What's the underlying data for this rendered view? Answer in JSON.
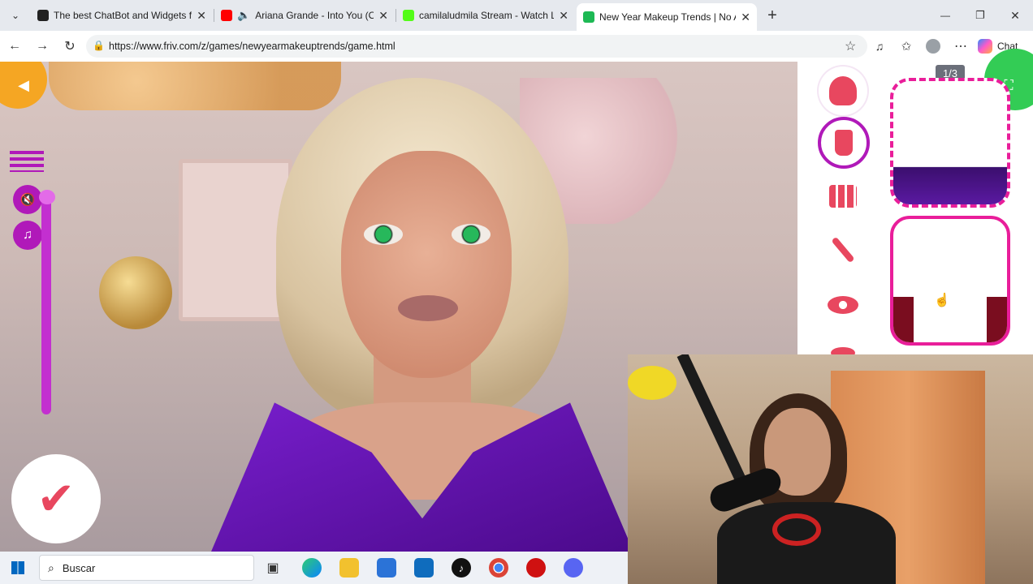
{
  "tabs": [
    {
      "title": "The best ChatBot and Widgets for",
      "favicon_color": "#222222"
    },
    {
      "title": "Ariana Grande - Into You (Offi",
      "favicon_color": "#ff0000"
    },
    {
      "title": "camilaludmila Stream - Watch Live",
      "favicon_color": "#53fc18"
    },
    {
      "title": "New Year Makeup Trends | No Ads",
      "favicon_color": "#1db954"
    }
  ],
  "close_glyph": "✕",
  "new_tab_glyph": "+",
  "window_controls": {
    "minimize": "—",
    "restore": "❐",
    "close": "✕"
  },
  "url": "https://www.friv.com/z/games/newyearmakeuptrends/game.html",
  "chat_label": "Chat",
  "game": {
    "page_indicator": "1/3",
    "categories": [
      "hair-icon",
      "top-icon",
      "palette-icon",
      "brush-icon",
      "eye-icon",
      "lips-icon"
    ],
    "selected_category": "top-icon",
    "confirm_glyph": "✔",
    "back_glyph": "◀"
  },
  "taskbar": {
    "search_placeholder": "Buscar",
    "apps": [
      "task-view",
      "edge",
      "file-explorer",
      "store",
      "outlook",
      "tiktok",
      "chrome",
      "red-app",
      "discord"
    ]
  },
  "colors": {
    "accent_pink": "#e91e9a",
    "selected_purple": "#b019b9",
    "dress_purple": "#5a0f9c",
    "confirm_red": "#e8475f"
  }
}
